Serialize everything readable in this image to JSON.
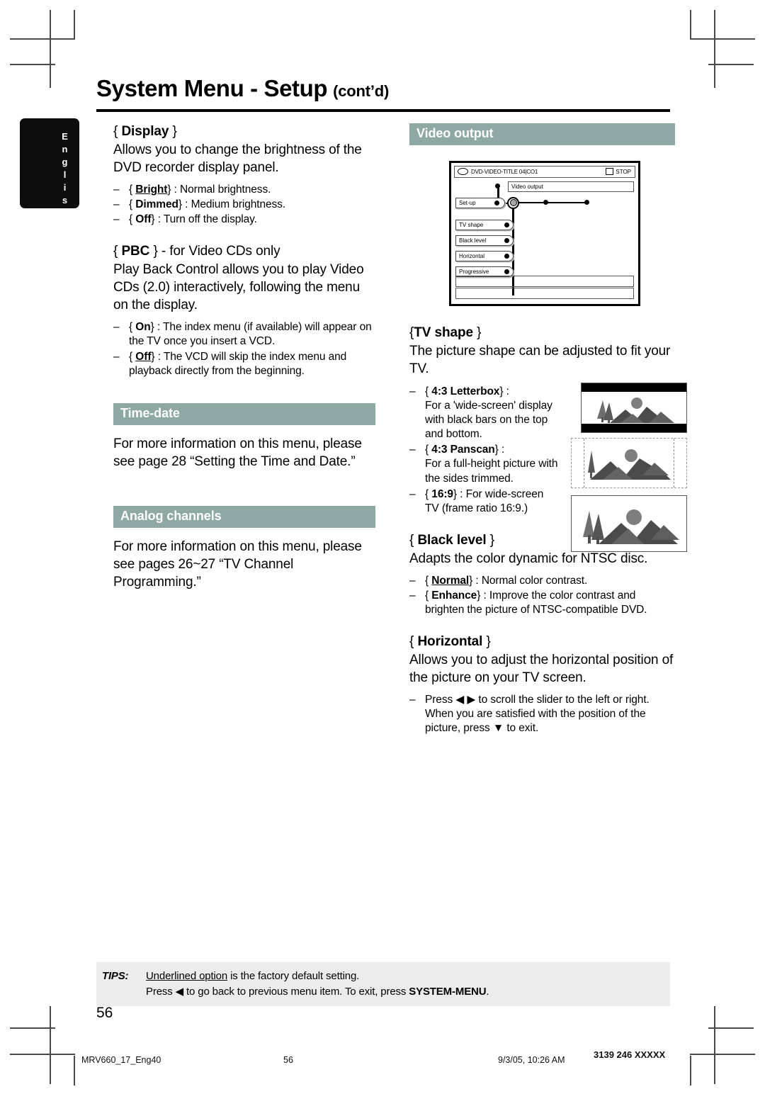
{
  "page": {
    "title_main": "System Menu - Setup",
    "title_suffix": "(cont’d)",
    "language_tab": "English",
    "folio": "56",
    "accent_bar_color": "#8ea8a5",
    "tips_bg_color": "#ececec"
  },
  "slug": {
    "file": "MRV660_17_Eng40",
    "page": "56",
    "timestamp": "9/3/05, 10:26 AM",
    "doc_code": "3139 246 XXXXX"
  },
  "left_column": {
    "display": {
      "heading_open": "{",
      "heading": "Display",
      "heading_close": "}",
      "body": "Allows you to change the brightness of the DVD recorder display panel.",
      "options": [
        {
          "dash": "–",
          "open": "{",
          "name": "Bright",
          "underlined": true,
          "close": "}",
          "desc": ": Normal brightness."
        },
        {
          "dash": "–",
          "open": "{",
          "name": "Dimmed",
          "underlined": false,
          "close": "}",
          "desc": ": Medium brightness."
        },
        {
          "dash": "–",
          "open": "{",
          "name": "Off",
          "underlined": false,
          "close": "}",
          "desc": ": Turn off the display."
        }
      ]
    },
    "pbc": {
      "heading_open": "{",
      "heading": "PBC",
      "heading_close": "} - for Video CDs only",
      "body": "Play Back Control allows you to play Video CDs (2.0) interactively, following the menu on the display.",
      "options": [
        {
          "dash": "–",
          "open": "{",
          "name": "On",
          "underlined": false,
          "close": "}",
          "desc": ": The index menu (if available) will appear on the TV once you insert a VCD."
        },
        {
          "dash": "–",
          "open": "{",
          "name": "Off",
          "underlined": true,
          "close": "}",
          "desc": ": The VCD will skip the index menu and playback directly from the beginning."
        }
      ]
    },
    "time_date": {
      "bar_label": "Time-date",
      "body": "For more information on this menu, please see page 28 “Setting the Time and Date.”"
    },
    "analog_channels": {
      "bar_label": "Analog channels",
      "body": "For more information on this menu, please see pages 26~27 “TV Channel Programming.”"
    }
  },
  "right_column": {
    "video_output": {
      "bar_label": "Video output"
    },
    "osd": {
      "disc_icon": "disc-icon",
      "status_left": "DVD-VIDEO-TITLE 04|CO1",
      "stop_icon": "stop-icon",
      "status_right": "STOP",
      "title_field": "Video output",
      "menu_items": [
        {
          "label": "Set-up"
        },
        {
          "label": "TV shape"
        },
        {
          "label": "Black level"
        },
        {
          "label": "Horizontal"
        },
        {
          "label": "Progressive"
        }
      ]
    },
    "tv_shape": {
      "heading_open": "{",
      "heading": "TV shape",
      "heading_close": "}",
      "body": "The picture shape can be adjusted to fit your TV.",
      "options": [
        {
          "dash": "–",
          "open": "{",
          "name": "4:3 Letterbox",
          "close": "} :",
          "desc": "For a 'wide-screen' display with black bars on the top and bottom.",
          "pic": "letterbox"
        },
        {
          "dash": "–",
          "open": "{",
          "name": "4:3 Panscan",
          "close": "} :",
          "desc": "For a full-height picture with the sides trimmed.",
          "pic": "panscan"
        },
        {
          "dash": "–",
          "open": "{",
          "name": "16:9",
          "close": "} :",
          "desc": "For wide-screen TV (frame ratio 16:9.)",
          "pic": "widescreen"
        }
      ]
    },
    "black_level": {
      "heading_open": "{",
      "heading": "Black level",
      "heading_close": "}",
      "body": "Adapts the color dynamic for NTSC disc.",
      "options": [
        {
          "dash": "–",
          "open": "{",
          "name": "Normal",
          "underlined": true,
          "close": "}",
          "desc": ": Normal color contrast."
        },
        {
          "dash": "–",
          "open": "{",
          "name": "Enhance",
          "underlined": false,
          "close": "}",
          "desc": ": Improve the color contrast and brighten the picture of NTSC-compatible DVD."
        }
      ]
    },
    "horizontal": {
      "heading_open": "{",
      "heading": "Horizontal",
      "heading_close": "}",
      "body": "Allows you to adjust the horizontal position of the picture on your TV screen.",
      "options": [
        {
          "dash": "–",
          "desc_pre": "Press ",
          "left_arrow": "◀",
          "right_arrow": "▶",
          "desc_mid": " to scroll the slider to the left or right. When you are satisfied with the position of the picture, press ",
          "down_arrow": "▼",
          "desc_post": " to exit."
        }
      ]
    }
  },
  "tips": {
    "label": "TIPS:",
    "line1_underlined": "Underlined option",
    "line1_rest": " is the factory default setting.",
    "line2_pre": "Press ",
    "line2_arrow": "◀",
    "line2_mid": " to go back to previous menu item. To exit, press ",
    "line2_bold": "SYSTEM-MENU",
    "line2_post": "."
  }
}
